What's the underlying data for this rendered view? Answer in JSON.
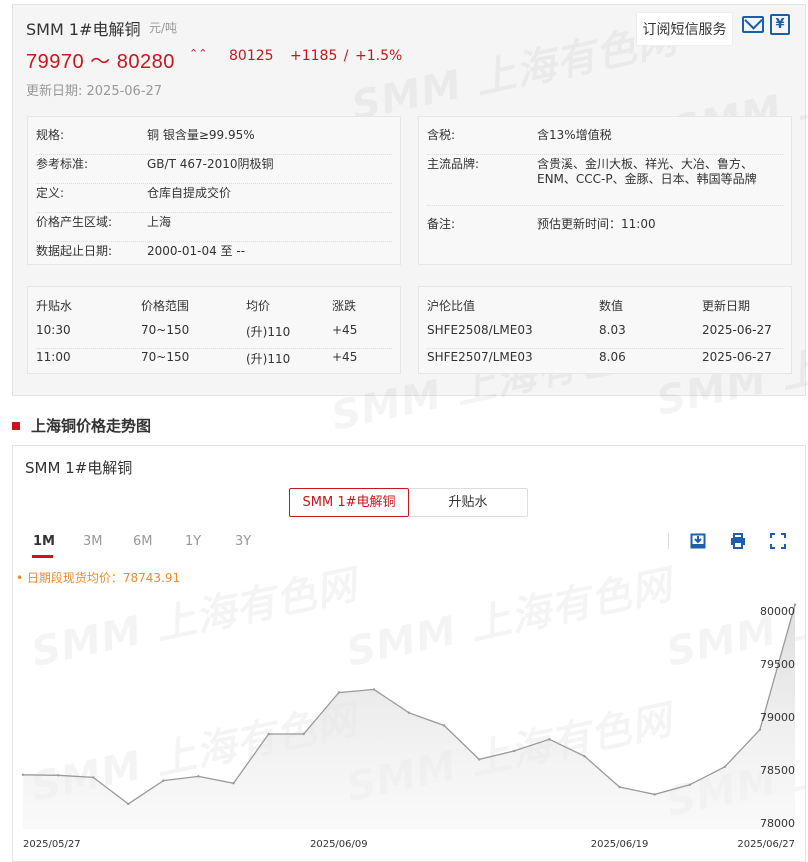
{
  "header": {
    "title": "SMM 1#电解铜",
    "unit": "元/吨",
    "subscribe_label": "订阅短信服务",
    "price_range": "79970 ～ 80280",
    "average": "80125",
    "change": "+1185  /  +1.5%",
    "update_date": "更新日期:  2025-06-27"
  },
  "icons": {
    "mail": "mail-icon",
    "calendar": "calendar-icon",
    "calendar_glyph": "¥",
    "trend": "trend-up-icon",
    "trend_glyph": "⌃⌃",
    "save": "save-image-icon",
    "print": "print-icon",
    "fullscreen": "fullscreen-icon"
  },
  "spec": {
    "left": [
      {
        "label": "规格:",
        "value": "铜 银含量≥99.95%"
      },
      {
        "label": "参考标准:",
        "value": "GB/T 467-2010阴极铜"
      },
      {
        "label": "定义:",
        "value": "仓库自提成交价"
      },
      {
        "label": "价格产生区域:",
        "value": "上海"
      },
      {
        "label": "数据起止日期:",
        "value": "2000-01-04 至 --"
      }
    ],
    "right": [
      {
        "label": "含税:",
        "value": "含13%增值税"
      },
      {
        "label": "主流品牌:",
        "value_line1": "含贵溪、金川大板、祥光、大冶、鲁方、",
        "value_line2": "ENM、CCC-P、金豚、日本、韩国等品牌"
      },
      {
        "label": "备注:",
        "value": "预估更新时间：11:00"
      }
    ]
  },
  "premium_table": {
    "headers": [
      "升贴水",
      "价格范围",
      "均价",
      "涨跌"
    ],
    "rows": [
      [
        "10:30",
        "70~150",
        "(升)110",
        "+45"
      ],
      [
        "11:00",
        "70~150",
        "(升)110",
        "+45"
      ]
    ]
  },
  "ratio_table": {
    "headers": [
      "沪伦比值",
      "数值",
      "更新日期"
    ],
    "rows": [
      [
        "SHFE2508/LME03",
        "8.03",
        "2025-06-27"
      ],
      [
        "SHFE2507/LME03",
        "8.06",
        "2025-06-27"
      ]
    ]
  },
  "section_title": "上海铜价格走势图",
  "chart_panel": {
    "title": "SMM 1#电解铜",
    "series_tabs": [
      "SMM 1#电解铜",
      "升贴水"
    ],
    "active_series": "SMM 1#电解铜",
    "range_tabs": [
      "1M",
      "3M",
      "6M",
      "1Y",
      "3Y"
    ],
    "active_range": "1M",
    "avg_label": "• 日期段现货均价：78743.91"
  },
  "watermark": "SMM 上海有色网",
  "colors": {
    "accent": "#c8161d",
    "icon_blue": "#1c5ea8",
    "avg_orange": "#e88c2c",
    "line": "#9a9a9a"
  },
  "chart_data": {
    "type": "area",
    "x_tick_labels": [
      "2025/05/27",
      "2025/06/09",
      "2025/06/19",
      "2025/06/27"
    ],
    "y_ticks": [
      78000,
      78500,
      79000,
      79500,
      80000
    ],
    "ylim": [
      78000,
      80100
    ],
    "grid": false,
    "series": [
      {
        "values": [
          78455,
          78450,
          78430,
          78180,
          78400,
          78440,
          78375,
          78840,
          78840,
          79230,
          79260,
          79040,
          78920,
          78600,
          78680,
          78790,
          78630,
          78340,
          78270,
          78360,
          78530,
          78880,
          80060
        ]
      }
    ]
  }
}
